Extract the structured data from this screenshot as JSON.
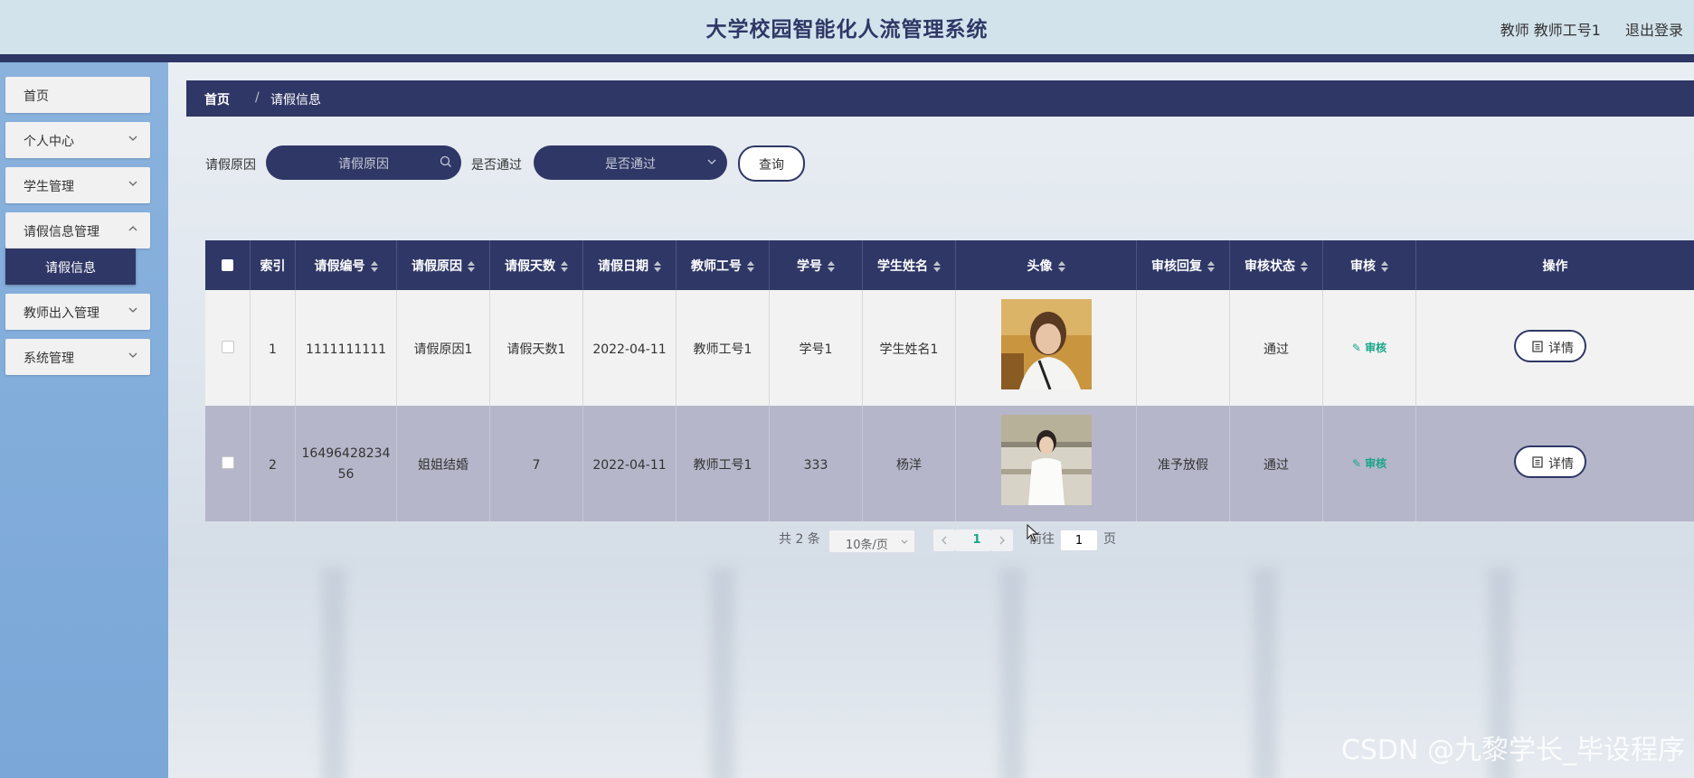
{
  "header": {
    "title": "大学校园智能化人流管理系统",
    "user": "教师 教师工号1",
    "logout": "退出登录"
  },
  "sidebar": {
    "items": [
      {
        "label": "首页"
      },
      {
        "label": "个人中心"
      },
      {
        "label": "学生管理"
      },
      {
        "label": "请假信息管理"
      },
      {
        "label": "教师出入管理"
      },
      {
        "label": "系统管理"
      }
    ],
    "active_sub": "请假信息"
  },
  "breadcrumb": {
    "home": "首页",
    "separator": "/",
    "current": "请假信息"
  },
  "search": {
    "reason_label": "请假原因",
    "reason_placeholder": "请假原因",
    "pass_label": "是否通过",
    "pass_placeholder": "是否通过",
    "query_button": "查询"
  },
  "table": {
    "columns": [
      "索引",
      "请假编号",
      "请假原因",
      "请假天数",
      "请假日期",
      "教师工号",
      "学号",
      "学生姓名",
      "头像",
      "审核回复",
      "审核状态",
      "审核",
      "操作"
    ],
    "rows": [
      {
        "index": "1",
        "leave_no": "1111111111",
        "reason": "请假原因1",
        "days": "请假天数1",
        "date": "2022-04-11",
        "teacher_no": "教师工号1",
        "student_no": "学号1",
        "student_name": "学生姓名1",
        "reply": "",
        "status": "通过",
        "audit": "审核",
        "action": "详情"
      },
      {
        "index": "2",
        "leave_no": "1649642823456",
        "leave_no_line1": "16496428234",
        "leave_no_line2": "56",
        "reason": "姐姐结婚",
        "days": "7",
        "date": "2022-04-11",
        "teacher_no": "教师工号1",
        "student_no": "333",
        "student_name": "杨洋",
        "reply": "准予放假",
        "status": "通过",
        "audit": "审核",
        "action": "详情"
      }
    ]
  },
  "pagination": {
    "total": "共 2 条",
    "page_size": "10条/页",
    "current_page": "1",
    "goto_label": "前往",
    "goto_value": "1",
    "page_suffix": "页"
  },
  "watermark": "CSDN @九黎学长_毕设程序",
  "colors": {
    "primary": "#2f3766",
    "accent": "#17a589",
    "sidebar": "#8ab2dd"
  }
}
